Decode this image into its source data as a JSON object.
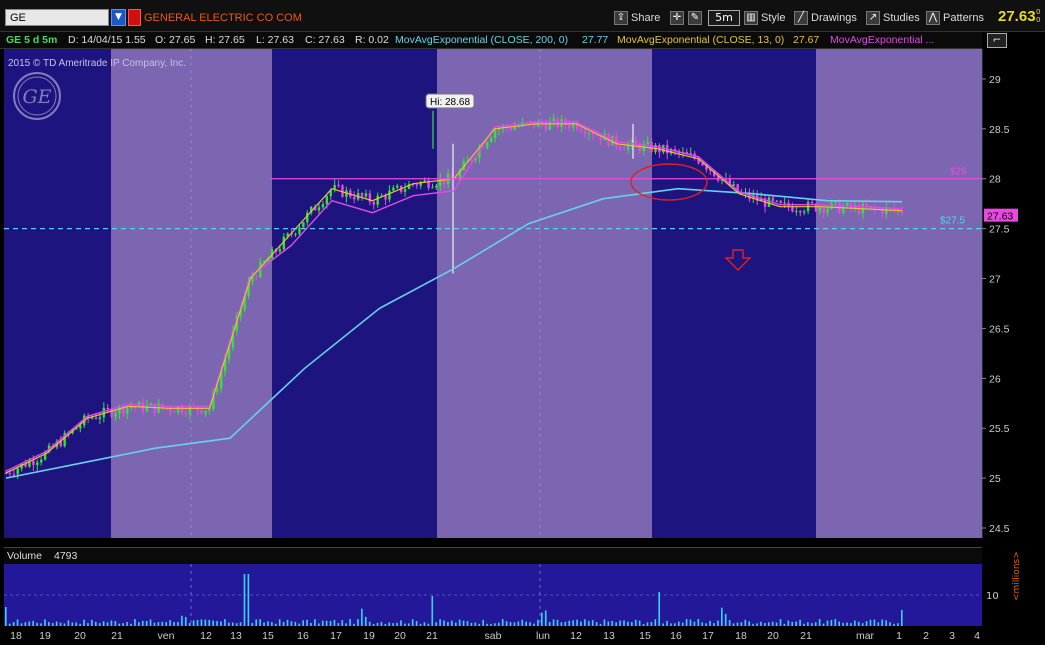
{
  "toolbar": {
    "symbol": "GE",
    "company": "GENERAL ELECTRIC CO COM",
    "share_label": "Share",
    "interval": "5m",
    "style_label": "Style",
    "drawings_label": "Drawings",
    "studies_label": "Studies",
    "patterns_label": "Patterns",
    "last_price": "27.63",
    "last_price_small": [
      "0",
      "0"
    ]
  },
  "infobar": {
    "title": "GE 5 d 5m",
    "date": "D: 14/04/15 1.55",
    "open": "O: 27.65",
    "high": "H: 27.65",
    "low": "L: 27.63",
    "close": "C: 27.63",
    "range": "R: 0.02",
    "ema200_label": "MovAvgExponential (CLOSE, 200, 0)",
    "ema200_value": "27.77",
    "ema13_label": "MovAvgExponential (CLOSE, 13, 0)",
    "ema13_value": "27.67",
    "ema3_label": "MovAvgExponential ..."
  },
  "copyright": "2015 © TD Ameritrade IP Company, Inc.",
  "logo_text": "GE",
  "annotations": {
    "hi_label": "Hi: 28.68",
    "line28_label": "$28",
    "line275_label": "$27.5",
    "current_price": "27.63"
  },
  "volume": {
    "label": "Volume",
    "value": "4793",
    "axis_tick": "10",
    "axis_unit": "<millions>"
  },
  "colors": {
    "bg_dark": "#1e1480",
    "bg_light": "#7c66b2",
    "ema200": "#66d2e8",
    "ema13": "#e8c23a",
    "ema3": "#e04ae6",
    "line28": "#ea4ae0",
    "line275": "#4ad6f0",
    "bull": "#38e038",
    "bear": "#e84ae0",
    "orange": "#e85a16",
    "yellow": "#eadb22"
  },
  "chart_data": {
    "type": "line",
    "ylim": [
      24.4,
      29.3
    ],
    "price_ticks": [
      "29",
      "28.5",
      "28",
      "27.5",
      "27",
      "26.5",
      "26",
      "25.5",
      "25",
      "24.5"
    ],
    "time_ticks": [
      "18",
      "19",
      "20",
      "21",
      "ven",
      "12",
      "13",
      "15",
      "16",
      "17",
      "19",
      "20",
      "21",
      "sab",
      "lun",
      "12",
      "13",
      "15",
      "16",
      "17",
      "18",
      "20",
      "21",
      "mar",
      "1",
      "2",
      "3",
      "4"
    ],
    "series": [
      {
        "name": "MovAvgExponential (CLOSE, 13, 0)",
        "values": [
          25.05,
          25.25,
          25.6,
          25.72,
          25.7,
          25.7,
          27.0,
          27.45,
          27.9,
          27.78,
          27.95,
          28.0,
          28.5,
          28.55,
          28.55,
          28.35,
          28.3,
          28.2,
          27.85,
          27.72,
          27.72,
          27.7,
          27.68
        ]
      },
      {
        "name": "MovAvgExponential (CLOSE, 200, 0)",
        "values": [
          25.0,
          25.15,
          25.3,
          25.4,
          26.1,
          26.7,
          27.1,
          27.55,
          27.8,
          27.9,
          27.85,
          27.78,
          27.77
        ]
      }
    ],
    "annotations": {
      "high": 28.68,
      "horizontal_lines": [
        28.0,
        27.5
      ],
      "last": 27.63
    }
  }
}
